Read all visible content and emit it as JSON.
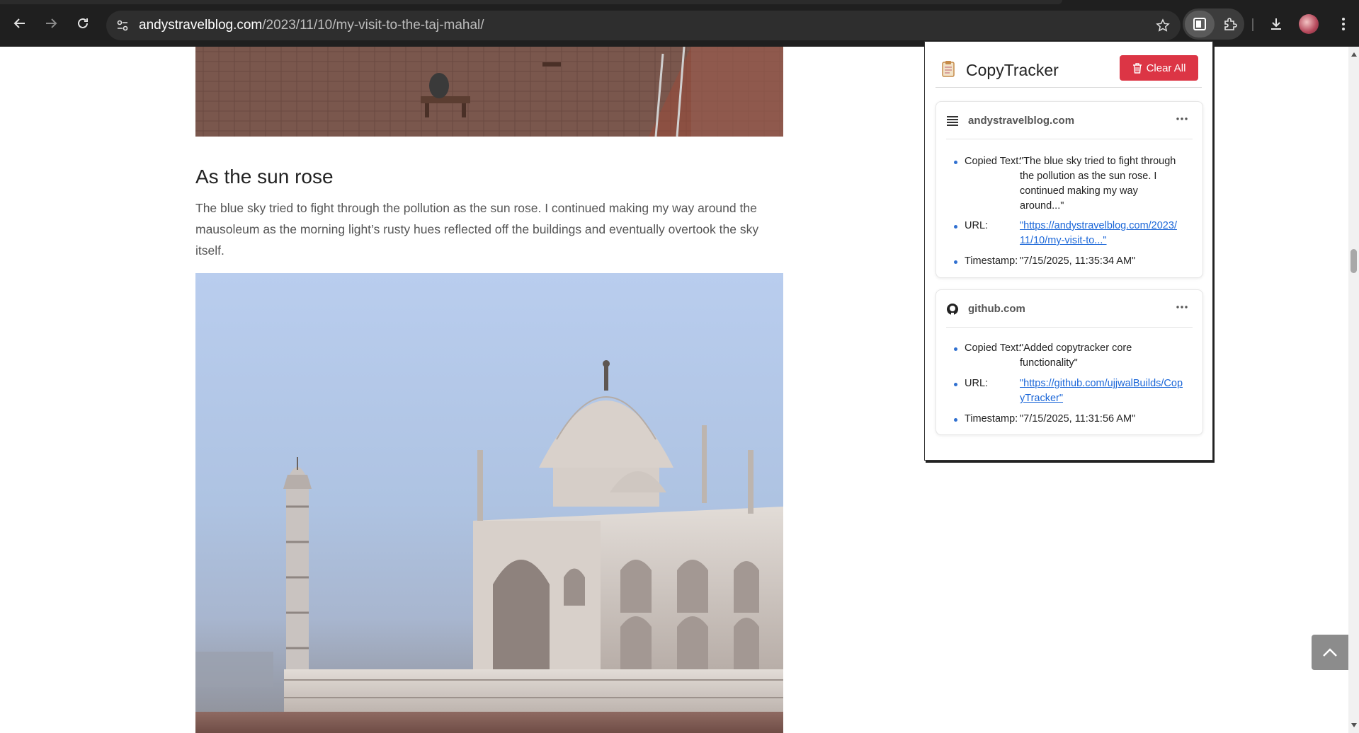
{
  "browser": {
    "url_host": "andystravelblog.com",
    "url_path": "/2023/11/10/my-visit-to-the-taj-mahal/",
    "icons": {
      "back": "arrow-left-icon",
      "forward": "arrow-right-icon",
      "reload": "reload-icon",
      "site_info": "tune-icon",
      "bookmark": "star-icon",
      "extension_active": "copytracker-extension-icon",
      "extensions": "puzzle-icon",
      "downloads": "download-icon",
      "profile": "avatar"
    }
  },
  "article": {
    "heading": "As the sun rose",
    "paragraph": "The blue sky tried to fight through the pollution as the sun rose.  I continued making my way around the mausoleum as the morning light’s rusty hues reflected off the buildings and eventually overtook the sky itself.",
    "top_image": "photo-taj-mahal-courtyard",
    "main_image": "photo-taj-mahal-sunrise"
  },
  "popup": {
    "title": "CopyTracker",
    "clear_label": "Clear All",
    "accent_color": "#dc3545",
    "labels": {
      "copied_text": "Copied Text:",
      "url": "URL:",
      "timestamp": "Timestamp:"
    },
    "entries": [
      {
        "domain": "andystravelblog.com",
        "favicon": "andys-travel-blog-favicon",
        "copied_text": "\"The blue sky tried to fight through the pollution as the sun rose.  I continued making my way around...\"",
        "url": "\"https://andystravelblog.com/2023/11/10/my-visit-to...\"",
        "timestamp": "\"7/15/2025, 11:35:34 AM\""
      },
      {
        "domain": "github.com",
        "favicon": "github-icon",
        "copied_text": "\"Added copytracker core functionality\"",
        "url": "\"https://github.com/ujjwalBuilds/CopyTracker\"",
        "timestamp": "\"7/15/2025, 11:31:56 AM\""
      }
    ]
  }
}
